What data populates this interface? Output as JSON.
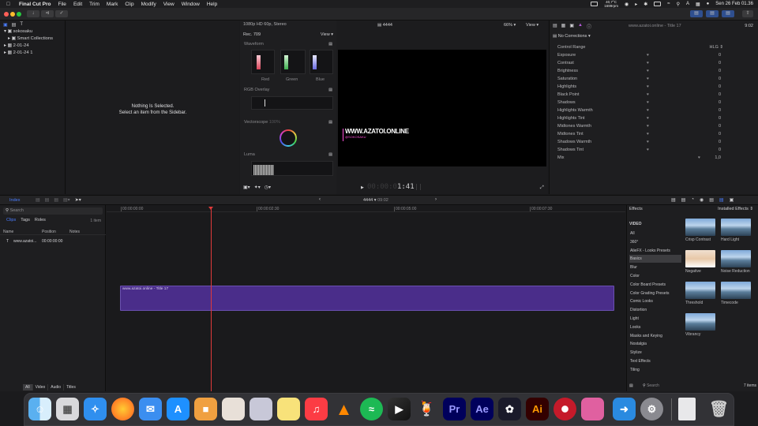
{
  "menubar": {
    "app_name": "Final Cut Pro",
    "items": [
      "File",
      "Edit",
      "Trim",
      "Mark",
      "Clip",
      "Modify",
      "View",
      "Window",
      "Help"
    ],
    "temp": "40,7°C",
    "rpm": "1699rpm",
    "datetime": "Sen 26 Feb  01.36"
  },
  "library": {
    "name": "sokosaku",
    "items": [
      "Smart Collections",
      "2-01-24",
      "2-01-24 1"
    ]
  },
  "browser": {
    "empty_line1": "Nothing Is Selected.",
    "empty_line2": "Select an item from the Sidebar."
  },
  "viewer": {
    "format": "1080p HD 60p, Stereo",
    "project": "4444",
    "zoom": "66%",
    "view_label": "View",
    "timecode_dim": "00:00:0",
    "timecode": "1:41",
    "overlay_title": "WWW.AZATOI.ONLINE",
    "overlay_sub": "@SOKOSAKU"
  },
  "scopes": {
    "color_space": "Rec. 709",
    "view_label": "View",
    "waveform_title": "Waveform",
    "channels": [
      "Red",
      "Green",
      "Blue"
    ],
    "rgb_title": "RGB Overlay",
    "vectorscope_title": "Vectorscope",
    "vectorscope_extra": "100%",
    "luma_title": "Luma"
  },
  "inspector": {
    "title": "www.azatoi.online - Title 17",
    "duration": "9:02",
    "corrections": "No Corrections",
    "rows": [
      {
        "label": "Control Range",
        "value": "HLG"
      },
      {
        "label": "Exposure",
        "value": "0"
      },
      {
        "label": "Contrast",
        "value": "0"
      },
      {
        "label": "Brightness",
        "value": "0"
      },
      {
        "label": "Saturation",
        "value": "0"
      },
      {
        "label": "Highlights",
        "value": "0"
      },
      {
        "label": "Black Point",
        "value": "0"
      },
      {
        "label": "Shadows",
        "value": "0"
      },
      {
        "label": "Highlights Warmth",
        "value": "0"
      },
      {
        "label": "Highlights Tint",
        "value": "0"
      },
      {
        "label": "Midtones Warmth",
        "value": "0"
      },
      {
        "label": "Midtones Tint",
        "value": "0"
      },
      {
        "label": "Shadows Warmth",
        "value": "0"
      },
      {
        "label": "Shadows Tint",
        "value": "0"
      },
      {
        "label": "Mix",
        "value": "1,0"
      }
    ]
  },
  "timeline_bar": {
    "index_label": "Index",
    "project": "4444",
    "duration": "09:02"
  },
  "index": {
    "search_placeholder": "Search",
    "tabs": [
      "Clips",
      "Tags",
      "Roles"
    ],
    "count": "1 item",
    "columns": [
      "Name",
      "Position",
      "Notes"
    ],
    "rows": [
      {
        "name": "www.azatoi...",
        "position": "00:00:00:00"
      }
    ],
    "footer_tabs": [
      "All",
      "Video",
      "Audio",
      "Titles"
    ]
  },
  "timeline": {
    "ruler": [
      "00:00:00:00",
      "00:00:02:30",
      "00:00:05:00",
      "00:00:07:30"
    ],
    "clip_label": "www.azatoi.online - Title 17",
    "clip_color": "#4a2d8a"
  },
  "effects": {
    "title": "Effects",
    "installed": "Installed Effects",
    "section": "VIDEO",
    "categories": [
      "All",
      "360°",
      "AlieFX - Looks Presets",
      "Basics",
      "Blur",
      "Color",
      "Color Board Presets",
      "Color Grading Presets",
      "Comic Looks",
      "Distortion",
      "Light",
      "Looks",
      "Masks and Keying",
      "Nostalgia",
      "Stylize",
      "Text Effects",
      "Tiling"
    ],
    "selected_category": "Basics",
    "thumbs": [
      "Crisp Contrast",
      "Hard Light",
      "Negative",
      "Noise Reduction",
      "Threshold",
      "Timecode",
      "Vibrancy"
    ],
    "search_placeholder": "Search",
    "count": "7 items"
  },
  "dock": {
    "items": [
      "finder-icon",
      "launchpad-icon",
      "safari-icon",
      "firefox-icon",
      "mail-icon",
      "app-store-icon",
      "utility-icon",
      "anime-icon-1",
      "anime-icon-2",
      "notes-icon",
      "music-icon",
      "vlc-icon",
      "spotify-icon",
      "final-cut-pro-icon",
      "cocktail-icon",
      "premiere-pro-icon",
      "after-effects-icon",
      "davinci-resolve-icon",
      "illustrator-icon",
      "red-app-icon",
      "pink-app-icon",
      "migration-icon",
      "system-settings-icon",
      "document-icon",
      "trash-icon"
    ],
    "labels": {
      "premiere": "Pr",
      "after_effects": "Ae",
      "illustrator": "Ai"
    }
  }
}
